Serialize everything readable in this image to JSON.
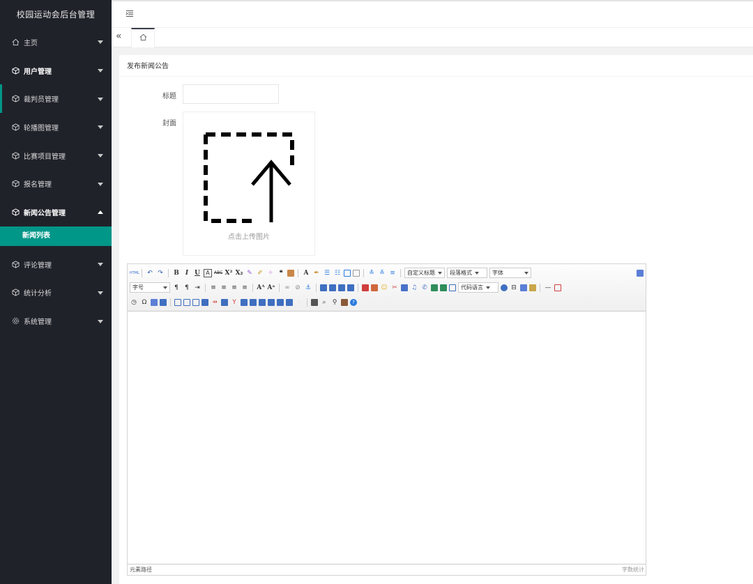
{
  "app": {
    "title": "校园运动会后台管理"
  },
  "sidebar": {
    "items": [
      {
        "label": "主页",
        "icon": "home-icon"
      },
      {
        "label": "用户管理",
        "icon": "cube-icon"
      },
      {
        "label": "裁判员管理",
        "icon": "cube-icon"
      },
      {
        "label": "轮播图管理",
        "icon": "cube-icon"
      },
      {
        "label": "比赛项目管理",
        "icon": "cube-icon"
      },
      {
        "label": "报名管理",
        "icon": "cube-icon"
      },
      {
        "label": "新闻公告管理",
        "icon": "cube-icon"
      },
      {
        "label": "评论管理",
        "icon": "cube-icon"
      },
      {
        "label": "统计分析",
        "icon": "cube-icon"
      },
      {
        "label": "系统管理",
        "icon": "gear-icon"
      }
    ],
    "active_sub": "新闻列表"
  },
  "page": {
    "title": "发布新闻公告"
  },
  "form": {
    "title_label": "标题",
    "title_value": "",
    "cover_label": "封面",
    "upload_text": "点击上传图片"
  },
  "editor": {
    "custom_heading": "自定义标题",
    "paragraph_format": "段落格式",
    "font_family": "字体",
    "font_size": "字号",
    "code_language": "代码语言",
    "status_path": "元素路径",
    "word_count": "字数统计"
  },
  "colors": {
    "sidebar_bg": "#20222a",
    "accent": "#009688"
  }
}
